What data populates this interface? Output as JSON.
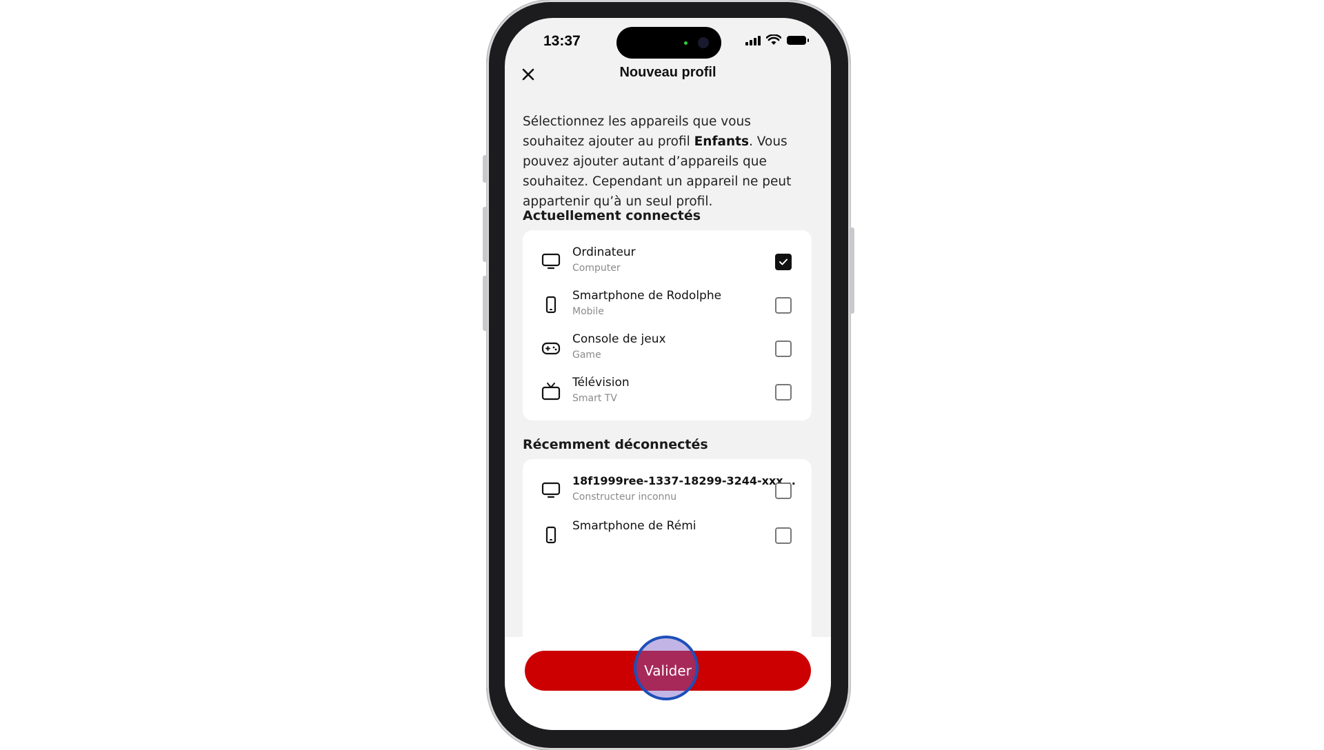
{
  "status_bar": {
    "time": "13:37"
  },
  "header": {
    "title": "Nouveau profil"
  },
  "intro": {
    "part1": "Sélectionnez les appareils que vous souhaitez ajouter au profil ",
    "profile_name": "Enfants",
    "part2": ". Vous pouvez ajouter autant d’appareils que souhaitez. Cependant un appareil ne peut appartenir qu’à un seul profil."
  },
  "connected": {
    "title": "Actuellement connectés",
    "devices": [
      {
        "name": "Ordinateur",
        "type": "Computer",
        "icon": "monitor-icon",
        "checked": true
      },
      {
        "name": "Smartphone de Rodolphe",
        "type": "Mobile",
        "icon": "smartphone-icon",
        "checked": false
      },
      {
        "name": "Console de jeux",
        "type": "Game",
        "icon": "gamepad-icon",
        "checked": false
      },
      {
        "name": "Télévision",
        "type": "Smart TV",
        "icon": "tv-icon",
        "checked": false
      }
    ]
  },
  "disconnected": {
    "title": "Récemment déconnectés",
    "devices": [
      {
        "name": "18f1999ree-1337-18299-3244-xxx...",
        "type": "Constructeur inconnu",
        "icon": "monitor-icon",
        "checked": false
      },
      {
        "name": "Smartphone de Rémi",
        "type": "",
        "icon": "smartphone-icon",
        "checked": false
      }
    ]
  },
  "footer": {
    "validate_label": "Valider"
  },
  "colors": {
    "primary": "#cc0000",
    "cursor": "#1d4fb8"
  }
}
